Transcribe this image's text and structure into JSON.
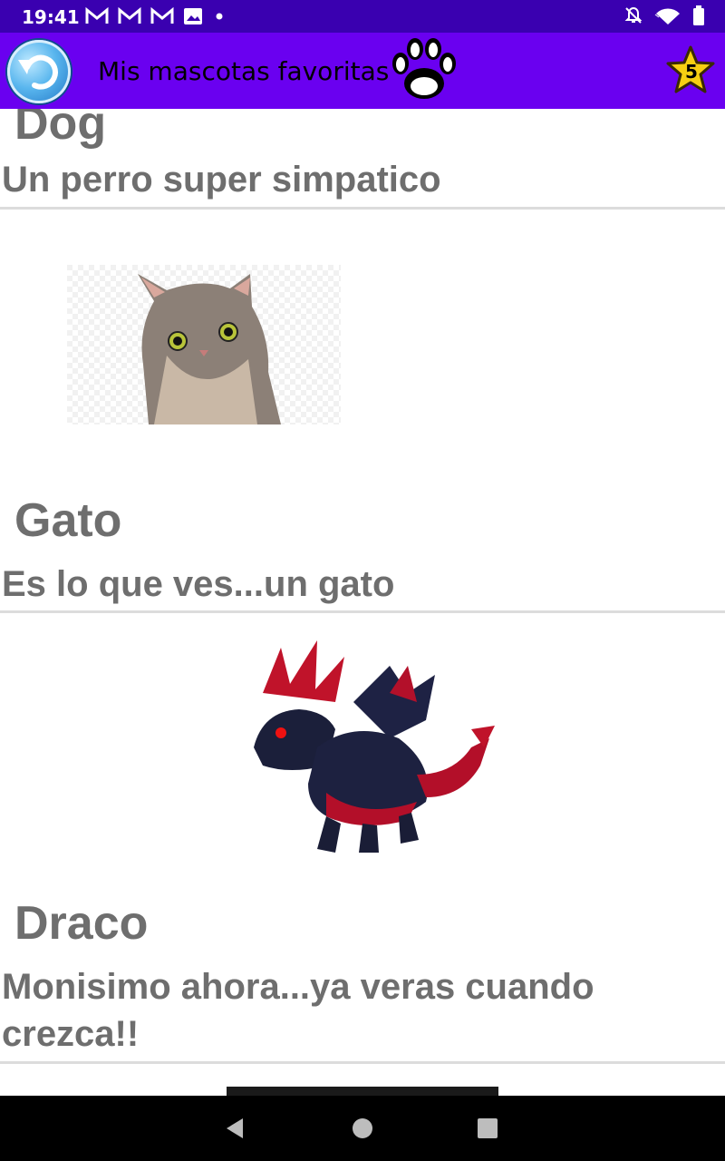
{
  "status_bar": {
    "time": "19:41",
    "left_icons": [
      "gmail-icon",
      "gmail-icon",
      "gmail-icon",
      "image-icon",
      "dot-icon"
    ],
    "right_icons": [
      "bell-off-icon",
      "wifi-icon",
      "battery-icon"
    ]
  },
  "app_bar": {
    "title": "Mis mascotas favoritas",
    "favorites_count": "5",
    "accent_color": "#6a00f0",
    "status_color": "#3a00b0"
  },
  "pets": [
    {
      "name": "Dog",
      "description": "Un perro super simpatico"
    },
    {
      "name": "Gato",
      "description": "Es lo que ves...un gato"
    },
    {
      "name": "Draco",
      "description": "Monisimo ahora...ya veras cuando crezca!!"
    }
  ]
}
